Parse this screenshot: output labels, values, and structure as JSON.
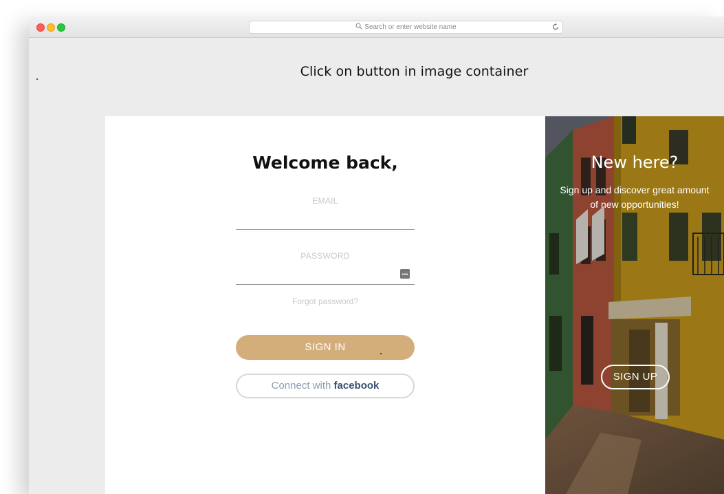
{
  "browser": {
    "url_placeholder": "Search or enter website name"
  },
  "page": {
    "instruction": "Click on button in image container"
  },
  "login": {
    "title": "Welcome back,",
    "email_label": "EMAIL",
    "email_value": "",
    "password_label": "PASSWORD",
    "password_value": "",
    "forgot_link": "Forgot password?",
    "signin_label": "SIGN IN",
    "facebook_prefix": "Connect with ",
    "facebook_brand": "facebook"
  },
  "signup_panel": {
    "title": "New here?",
    "subtitle": "Sign up and discover great amount of new opportunities!",
    "signup_label": "SIGN UP"
  },
  "colors": {
    "accent": "#d3ae7b",
    "facebook_brand": "#3b5071",
    "page_background": "#ececec"
  },
  "icons": {
    "url_search": "search-icon",
    "reload": "reload-icon",
    "password_manager": "password-key-icon"
  }
}
